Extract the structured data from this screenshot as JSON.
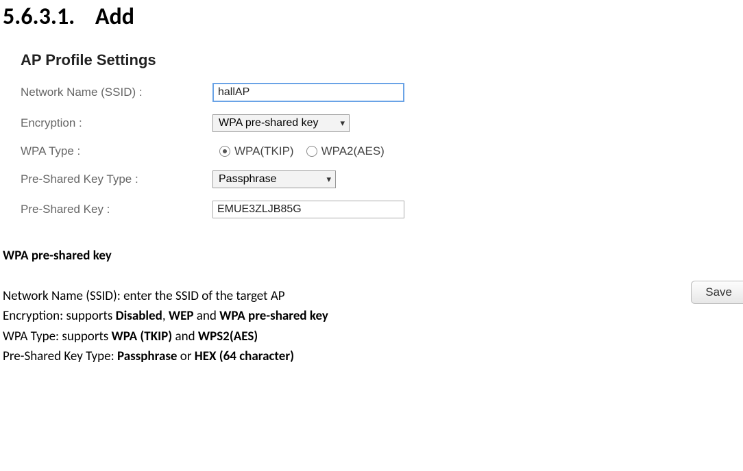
{
  "section": {
    "number": "5.6.3.1.",
    "title": "Add"
  },
  "panel": {
    "title": "AP Profile Settings",
    "labels": {
      "ssid": "Network Name (SSID) :",
      "encryption": "Encryption :",
      "wpa_type": "WPA Type :",
      "psk_type": "Pre-Shared Key Type :",
      "psk": "Pre-Shared Key :"
    },
    "values": {
      "ssid": "hallAP",
      "encryption": "WPA pre-shared key",
      "wpa_type_options": {
        "opt1": "WPA(TKIP)",
        "opt2": "WPA2(AES)"
      },
      "psk_type": "Passphrase",
      "psk": "EMUE3ZLJB85G"
    },
    "save_label": "Save"
  },
  "explain": {
    "heading": "WPA pre-shared key",
    "l1a": "Network Name (SSID): enter the SSID of the target AP",
    "l2a": "Encryption: supports ",
    "l2b": "Disabled",
    "l2c": ", ",
    "l2d": "WEP",
    "l2e": " and ",
    "l2f": "WPA pre-shared key",
    "l3a": "WPA Type: supports ",
    "l3b": "WPA (TKIP)",
    "l3c": " and ",
    "l3d": "WPS2(AES)",
    "l4a": "Pre-Shared Key Type: ",
    "l4b": "Passphrase",
    "l4c": " or ",
    "l4d": "HEX (64 character)"
  }
}
